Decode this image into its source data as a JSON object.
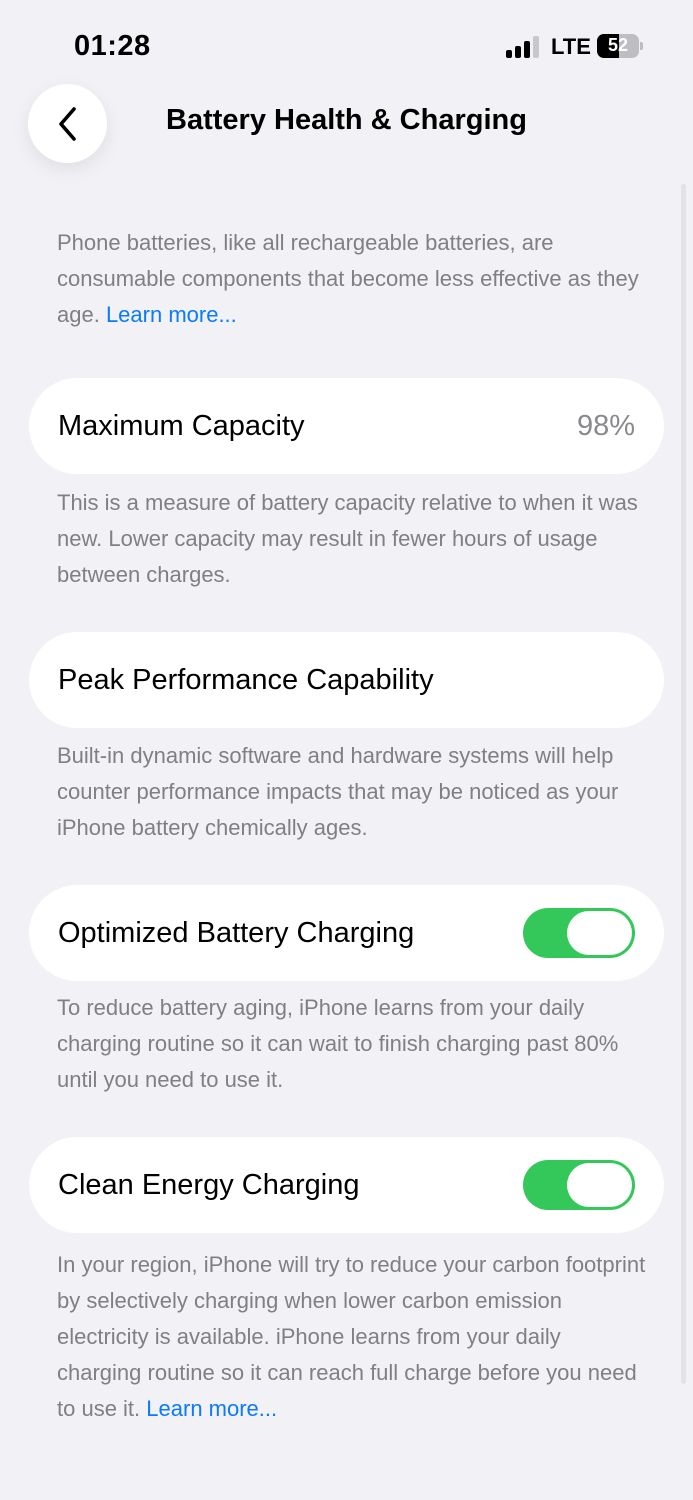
{
  "status_bar": {
    "time": "01:28",
    "network": "LTE",
    "battery_level": "52"
  },
  "header": {
    "title": "Battery Health & Charging"
  },
  "intro": {
    "text": "Phone batteries, like all rechargeable batteries, are consumable components that become less effective as they age. ",
    "link": "Learn more..."
  },
  "max_capacity": {
    "label": "Maximum Capacity",
    "value": "98%",
    "description": "This is a measure of battery capacity relative to when it was new. Lower capacity may result in fewer hours of usage between charges."
  },
  "peak_performance": {
    "label": "Peak Performance Capability",
    "description": "Built-in dynamic software and hardware systems will help counter performance impacts that may be noticed as your iPhone battery chemically ages."
  },
  "optimized_charging": {
    "label": "Optimized Battery Charging",
    "enabled": true,
    "description": "To reduce battery aging, iPhone learns from your daily charging routine so it can wait to finish charging past 80% until you need to use it."
  },
  "clean_energy": {
    "label": "Clean Energy Charging",
    "enabled": true,
    "description": "In your region, iPhone will try to reduce your carbon footprint by selectively charging when lower carbon emission electricity is available. iPhone learns from your daily charging routine so it can reach full charge before you need to use it. ",
    "link": "Learn more..."
  },
  "colors": {
    "accent": "#0a7aff",
    "toggle_on": "#34c759",
    "background": "#f1f1f6"
  },
  "icons": {
    "back": "chevron-left-icon"
  }
}
